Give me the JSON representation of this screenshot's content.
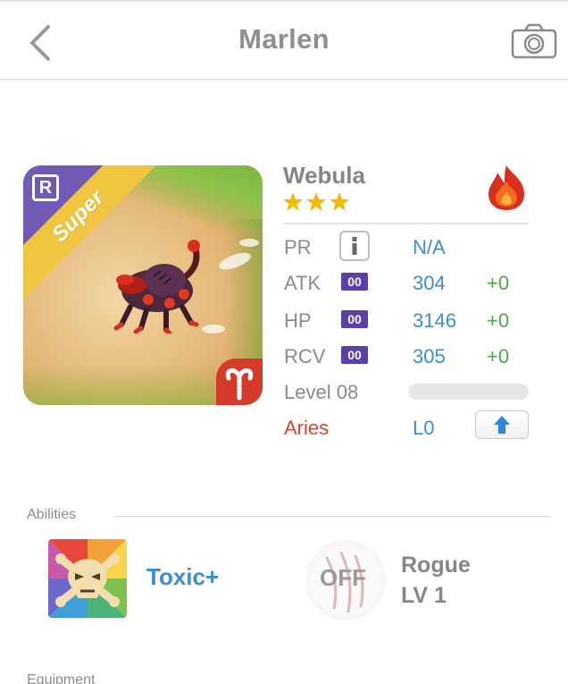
{
  "header": {
    "title": "Marlen",
    "back_icon": "chevron-left-icon",
    "camera_icon": "camera-icon"
  },
  "monster": {
    "name": "Webula",
    "stars": 3,
    "rarity_badge": "R",
    "tier_label": "Super",
    "element_icon": "fire-icon",
    "zodiac_icon": "aries-icon"
  },
  "stats": {
    "pr": {
      "label": "PR",
      "value": "N/A"
    },
    "atk": {
      "label": "ATK",
      "badge": "00",
      "value": "304",
      "plus": "+0"
    },
    "hp": {
      "label": "HP",
      "badge": "00",
      "value": "3146",
      "plus": "+0"
    },
    "rcv": {
      "label": "RCV",
      "badge": "00",
      "value": "305",
      "plus": "+0"
    },
    "level": {
      "label": "Level 08",
      "progress": 0
    },
    "zodiac": {
      "label": "Aries",
      "value": "L0"
    }
  },
  "abilities": {
    "section_label": "Abilities",
    "ability": {
      "name": "Toxic+"
    },
    "skill": {
      "status": "OFF",
      "name": "Rogue",
      "level": "LV 1"
    }
  },
  "equipment": {
    "section_label": "Equipment"
  },
  "colors": {
    "accent_blue": "#3a8fd0",
    "plus_green": "#4aa84a",
    "aries_red": "#d84335",
    "badge_purple": "#5d3fa8",
    "star_gold": "#f5b800"
  }
}
